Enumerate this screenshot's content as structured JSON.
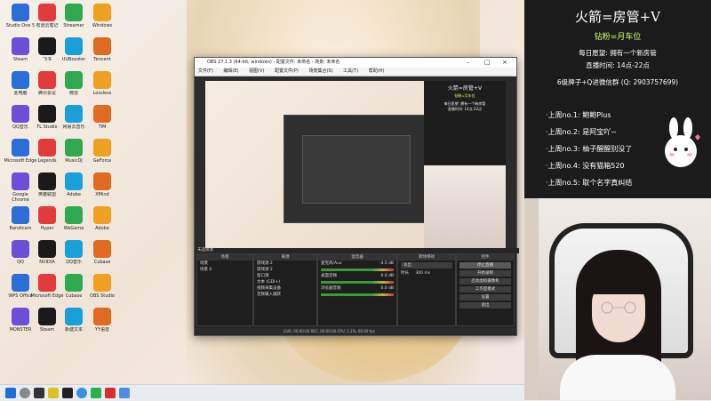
{
  "desktop": {
    "icons": [
      {
        "label": "Studio One 5"
      },
      {
        "label": "有道云笔记"
      },
      {
        "label": "Streamer"
      },
      {
        "label": "Windows"
      },
      {
        "label": "Steam"
      },
      {
        "label": "飞书"
      },
      {
        "label": "UUBooster"
      },
      {
        "label": "Tencent"
      },
      {
        "label": "此电脑"
      },
      {
        "label": "腾讯会议"
      },
      {
        "label": "微信"
      },
      {
        "label": "Lossless"
      },
      {
        "label": "QQ音乐"
      },
      {
        "label": "FL Studio"
      },
      {
        "label": "网易云音乐"
      },
      {
        "label": "TIM"
      },
      {
        "label": "Microsoft Edge"
      },
      {
        "label": "Legends"
      },
      {
        "label": "MusicDJ"
      },
      {
        "label": "GeForce"
      },
      {
        "label": "Google Chrome"
      },
      {
        "label": "英雄联盟"
      },
      {
        "label": "Adobe"
      },
      {
        "label": "XMind"
      },
      {
        "label": "Bandicam"
      },
      {
        "label": "Hyper"
      },
      {
        "label": "WeGame"
      },
      {
        "label": "Adobe"
      },
      {
        "label": "QQ"
      },
      {
        "label": "NVIDIA"
      },
      {
        "label": "QQ音乐"
      },
      {
        "label": "Cubase"
      },
      {
        "label": "WPS Office"
      },
      {
        "label": "Microsoft Edge"
      },
      {
        "label": "Cubase"
      },
      {
        "label": "OBS Studio"
      },
      {
        "label": "MONSTER"
      },
      {
        "label": "Steam"
      },
      {
        "label": "新建文本"
      },
      {
        "label": "YY语音"
      }
    ]
  },
  "taskbar": {
    "items": [
      "start",
      "search",
      "task-view",
      "explorer",
      "obs",
      "chrome",
      "wechat",
      "netease",
      "store"
    ]
  },
  "obs": {
    "title": "OBS 27.1.3 (64-bit, windows) - 配置文件: 未命名 - 场景: 未命名",
    "menu": [
      "文件(F)",
      "编辑(E)",
      "视图(V)",
      "配置文件(P)",
      "场景集合(S)",
      "工具(T)",
      "帮助(H)"
    ],
    "preview_label": "未选择源",
    "docks": {
      "scenes": {
        "header": "场景",
        "items": [
          "场景",
          "场景 2"
        ]
      },
      "sources": {
        "header": "来源",
        "items": [
          "游戏源 2",
          "游戏源 2",
          "窗口源",
          "文本 (GDI+)",
          "视频采集设备",
          "音频输入捕获"
        ]
      },
      "mixer": {
        "header": "混音器",
        "channels": [
          {
            "name": "麦克风/Aux",
            "db": "-4.5 dB"
          },
          {
            "name": "桌面音频",
            "db": "0.0 dB"
          },
          {
            "name": "浏览器音频",
            "db": "0.0 dB"
          }
        ]
      },
      "transitions": {
        "header": "转场特效",
        "type": "淡出",
        "duration_label": "时长",
        "duration": "300 ms"
      },
      "controls": {
        "header": "控件",
        "buttons": [
          "停止直播",
          "开始录制",
          "启动虚拟摄像机",
          "工作室模式",
          "设置",
          "退出"
        ]
      }
    },
    "status": "LIVE: 00:00:00   REC: 00:00:00   CPU: 1.1%, 60.00 fps"
  },
  "panel": {
    "title": "火箭=房管+V",
    "subtitle": "钻粉=月车位",
    "wish": "每日愿望: 拥有一个新房管",
    "hours": "直播时间: 14点-22点",
    "fan_group": "6级牌子+Q进微信群 (Q: 2903757699)",
    "leaderboard": [
      "·上周no.1: 鲍鲍Plus",
      "·上周no.2: 是阿宝吖~",
      "·上周no.3: 柚子醒醒别没了",
      "·上周no.4: 没有猫箱520",
      "·上周no.5: 取个名字真纠结"
    ]
  },
  "colors": {
    "panel_bg": "#1b1b1b",
    "obs_bg": "#2b2b2b",
    "accent": "#d9ff6a"
  }
}
